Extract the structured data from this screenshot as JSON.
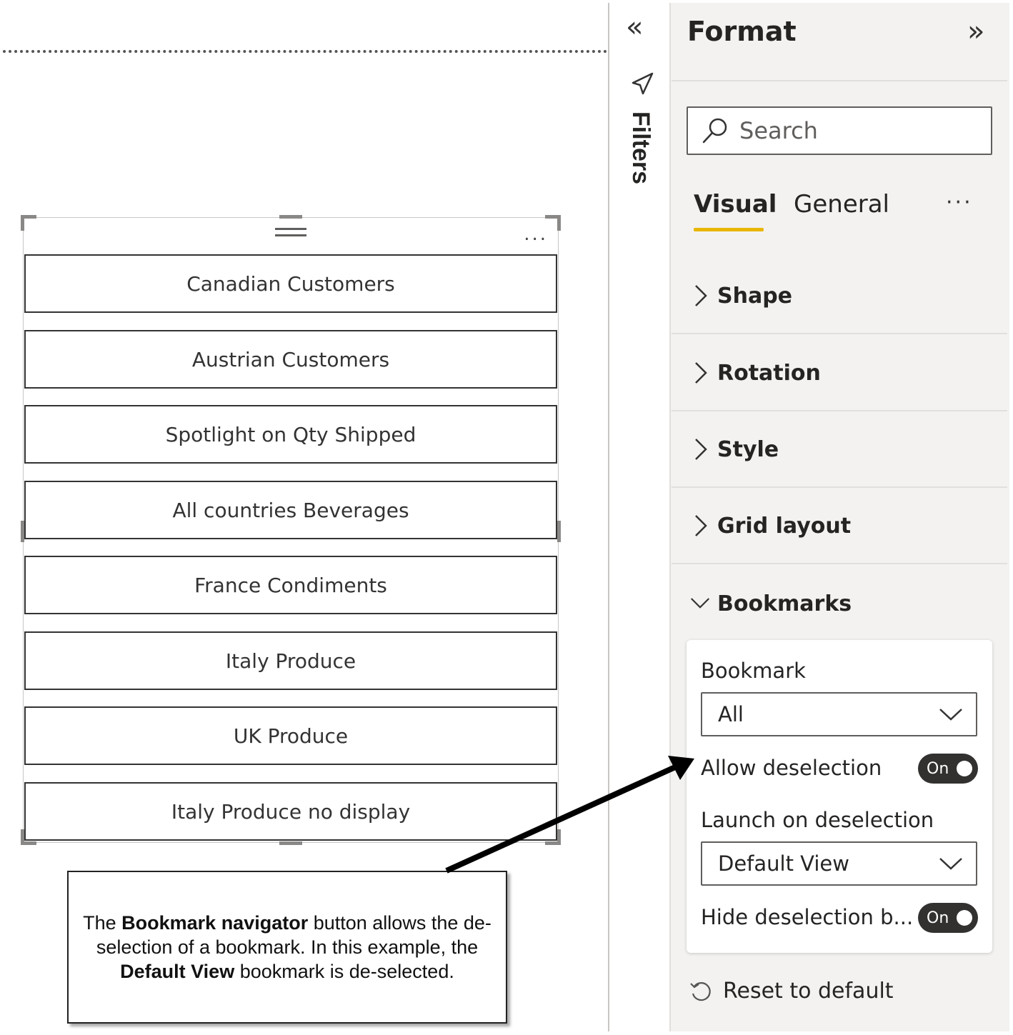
{
  "canvas": {
    "bookmark_buttons": [
      {
        "label": "Canadian Customers"
      },
      {
        "label": "Austrian Customers"
      },
      {
        "label": "Spotlight on Qty Shipped"
      },
      {
        "label": "All countries Beverages"
      },
      {
        "label": "France Condiments"
      },
      {
        "label": "Italy Produce"
      },
      {
        "label": "UK Produce"
      },
      {
        "label": "Italy Produce no display"
      }
    ],
    "visual_more": "...",
    "callout": {
      "part1": "The ",
      "bold1": "Bookmark navigator",
      "part2": " button allows the de-selection of a bookmark. In this example, the ",
      "bold2": "Default View",
      "part3": " bookmark is de-selected."
    }
  },
  "filters": {
    "collapse_icon": "double-chevron-left-icon",
    "label": "Filters"
  },
  "format_pane": {
    "title": "Format",
    "expand_icon": "double-chevron-right-icon",
    "search": {
      "placeholder": "Search"
    },
    "tabs": [
      {
        "label": "Visual",
        "active": true
      },
      {
        "label": "General",
        "active": false
      }
    ],
    "tabs_more": "···",
    "sections": [
      {
        "label": "Shape",
        "expanded": false
      },
      {
        "label": "Rotation",
        "expanded": false
      },
      {
        "label": "Style",
        "expanded": false
      },
      {
        "label": "Grid layout",
        "expanded": false
      },
      {
        "label": "Bookmarks",
        "expanded": true
      }
    ],
    "bookmarks_card": {
      "bookmark_label": "Bookmark",
      "bookmark_value": "All",
      "allow_deselection_label": "Allow deselection",
      "allow_deselection_toggle": "On",
      "launch_label": "Launch on deselection",
      "launch_value": "Default View",
      "hide_label": "Hide deselection b...",
      "hide_toggle": "On"
    },
    "reset_label": "Reset to default"
  },
  "colors": {
    "tab_underline": "#e8b600",
    "toggle_on": "#323130",
    "pane_bg": "#f3f2f1"
  }
}
